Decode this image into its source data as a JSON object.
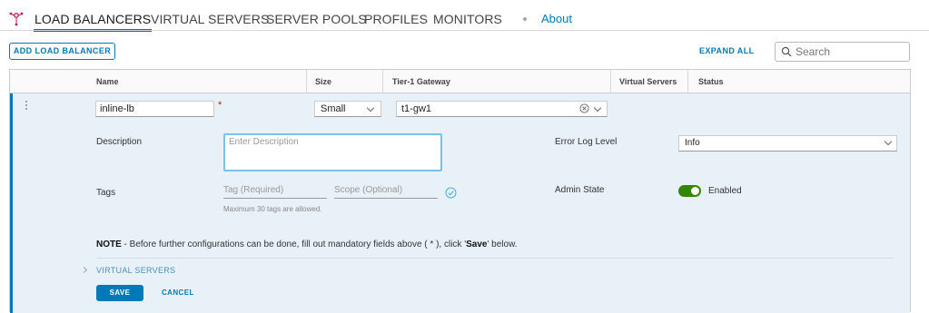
{
  "nav": {
    "tabs": [
      {
        "label": "LOAD BALANCERS",
        "active": true
      },
      {
        "label": "VIRTUAL SERVERS",
        "active": false
      },
      {
        "label": "SERVER POOLS",
        "active": false
      },
      {
        "label": "PROFILES",
        "active": false
      },
      {
        "label": "MONITORS",
        "active": false
      }
    ],
    "about": "About",
    "logo_icon": "network-hub-icon",
    "accent": "#0079b8"
  },
  "toolbar": {
    "add_label": "ADD LOAD BALANCER",
    "expand_all": "EXPAND ALL",
    "search_placeholder": "Search"
  },
  "grid": {
    "columns": [
      "Name",
      "Size",
      "Tier-1 Gateway",
      "Virtual Servers",
      "Status"
    ]
  },
  "form": {
    "name_value": "inline-lb",
    "required_mark": "*",
    "size_value": "Small",
    "gateway_value": "t1-gw1",
    "description_label": "Description",
    "description_placeholder": "Enter Description",
    "error_log_label": "Error Log Level",
    "error_log_value": "Info",
    "tags_label": "Tags",
    "tag_placeholder": "Tag (Required)",
    "scope_placeholder": "Scope (Optional)",
    "tags_hint": "Maximum 30 tags are allowed.",
    "admin_state_label": "Admin State",
    "admin_state_value": "Enabled",
    "admin_state_on": true,
    "note_prefix": "NOTE",
    "note_text_1": " - Before further configurations can be done, fill out mandatory fields above ( * ), click '",
    "note_save": "Save",
    "note_text_2": "' below.",
    "virtual_servers_link": "VIRTUAL SERVERS",
    "save_label": "SAVE",
    "cancel_label": "CANCEL",
    "toggle_color": "#318700"
  }
}
